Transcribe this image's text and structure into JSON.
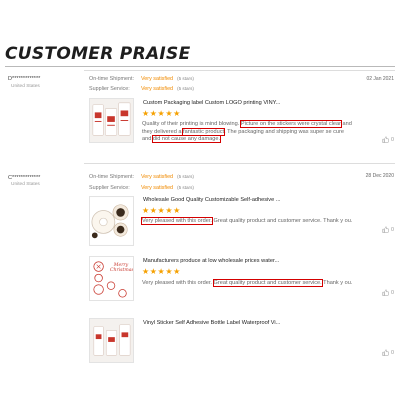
{
  "page_title": "CUSTOMER PRAISE",
  "labels": {
    "ontime": "On-time Shipment:",
    "service": "Supplier Service:"
  },
  "reviews": [
    {
      "reviewer": "D*************",
      "country": "United States",
      "ontime_value": "Very satisfied",
      "ontime_stars": "(5 stars)",
      "service_value": "Very satisfied",
      "service_stars": "(5 stars)",
      "date": "02 Jan 2021",
      "items": [
        {
          "title": "Custom Packaging label Custom LOGO printing VINY...",
          "stars": "★★★★★",
          "comment": {
            "p1": "Quality of their printing is mind blowing. ",
            "h1": "Picture on the stickers were crystal clear",
            "p2": " and they delivered a ",
            "h2": "fantastic product",
            "p3": ". The packaging and shipping was super se cure and ",
            "h3": "did not cause any damage.",
            "p4": ""
          },
          "likes": "0"
        }
      ]
    },
    {
      "reviewer": "C*************",
      "country": "United States",
      "ontime_value": "Very satisfied",
      "ontime_stars": "(5 stars)",
      "service_value": "Very satisfied",
      "service_stars": "(5 stars)",
      "date": "28 Dec 2020",
      "items": [
        {
          "title": "Wholesale Good Quality Customizable Self-adhesive ...",
          "stars": "★★★★★",
          "comment": {
            "h1": "Very pleased with this order.",
            "p1": " Great quality product and customer service. Thank y ou."
          },
          "likes": "0"
        },
        {
          "title": "Manufacturers produce at low wholesale prices water...",
          "stars": "★★★★★",
          "comment": {
            "p1": "Very pleased with this order. ",
            "h1": "Great quality product and customer service.",
            "p2": " Thank y ou."
          },
          "likes": "0",
          "thumb_text": "Merry Christmas"
        },
        {
          "title": "Vinyl Sticker Self Adhesive Bottle Label Waterproof Vi...",
          "likes": "0"
        }
      ]
    }
  ],
  "colors": {
    "accent_orange": "#f08a00",
    "star_gold": "#f5a000",
    "highlight_red": "#d40000"
  },
  "icons": {
    "like": "thumbs-up-icon"
  }
}
